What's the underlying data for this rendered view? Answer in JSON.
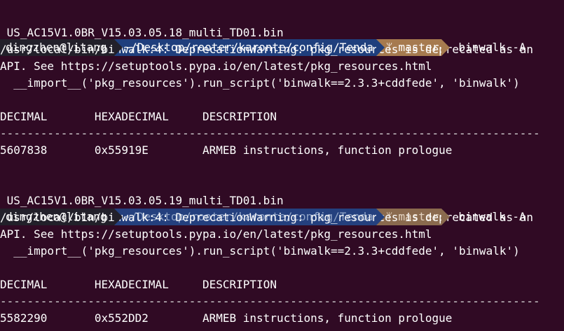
{
  "colors": {
    "background": "#300a24",
    "user_segment_bg": "#22202a",
    "dir_segment_bg_active": "#1f3f7d",
    "dir_segment_bg_inactive": "#24407e",
    "dir_text_inactive": "#8fa3c6",
    "git_segment_bg_active": "#a67a4f",
    "git_segment_bg_inactive": "#8a6a4e",
    "git_text_inactive": "#e3d3c0",
    "text": "#ffffff"
  },
  "blocks": [
    {
      "user": "dingzhen@litang",
      "dir": "~/Desktop/rooter/karonte/config/Tenda",
      "branch_icon": "git-branch-icon",
      "branch": "master",
      "command": "binwalk -A",
      "command_cont": " US_AC15V1.0BR_V15.03.05.18_multi_TD01.bin",
      "warning_1": "/usr/local/bin/binwalk:4: DeprecationWarning: pkg_resources is deprecated as an",
      "warning_2": "API. See https://setuptools.pypa.io/en/latest/pkg_resources.html",
      "warning_3": "  __import__('pkg_resources').run_script('binwalk==2.3.3+cddfede', 'binwalk')",
      "header": "DECIMAL       HEXADECIMAL     DESCRIPTION",
      "separator": "--------------------------------------------------------------------------------",
      "row": "5607838       0x55919E        ARMEB instructions, function prologue"
    },
    {
      "user": "dingzhen@litang",
      "dir": "~/Desktop/rooter/karonte/config/Tenda",
      "branch_icon": "git-branch-icon",
      "branch": "master",
      "command": "binwalk -A",
      "command_cont": " US_AC15V1.0BR_V15.03.05.19_multi_TD01.bin",
      "warning_1": "/usr/local/bin/binwalk:4: DeprecationWarning: pkg_resources is deprecated as an",
      "warning_2": "API. See https://setuptools.pypa.io/en/latest/pkg_resources.html",
      "warning_3": "  __import__('pkg_resources').run_script('binwalk==2.3.3+cddfede', 'binwalk')",
      "header": "DECIMAL       HEXADECIMAL     DESCRIPTION",
      "separator": "--------------------------------------------------------------------------------",
      "row": "5582290       0x552DD2        ARMEB instructions, function prologue"
    }
  ]
}
